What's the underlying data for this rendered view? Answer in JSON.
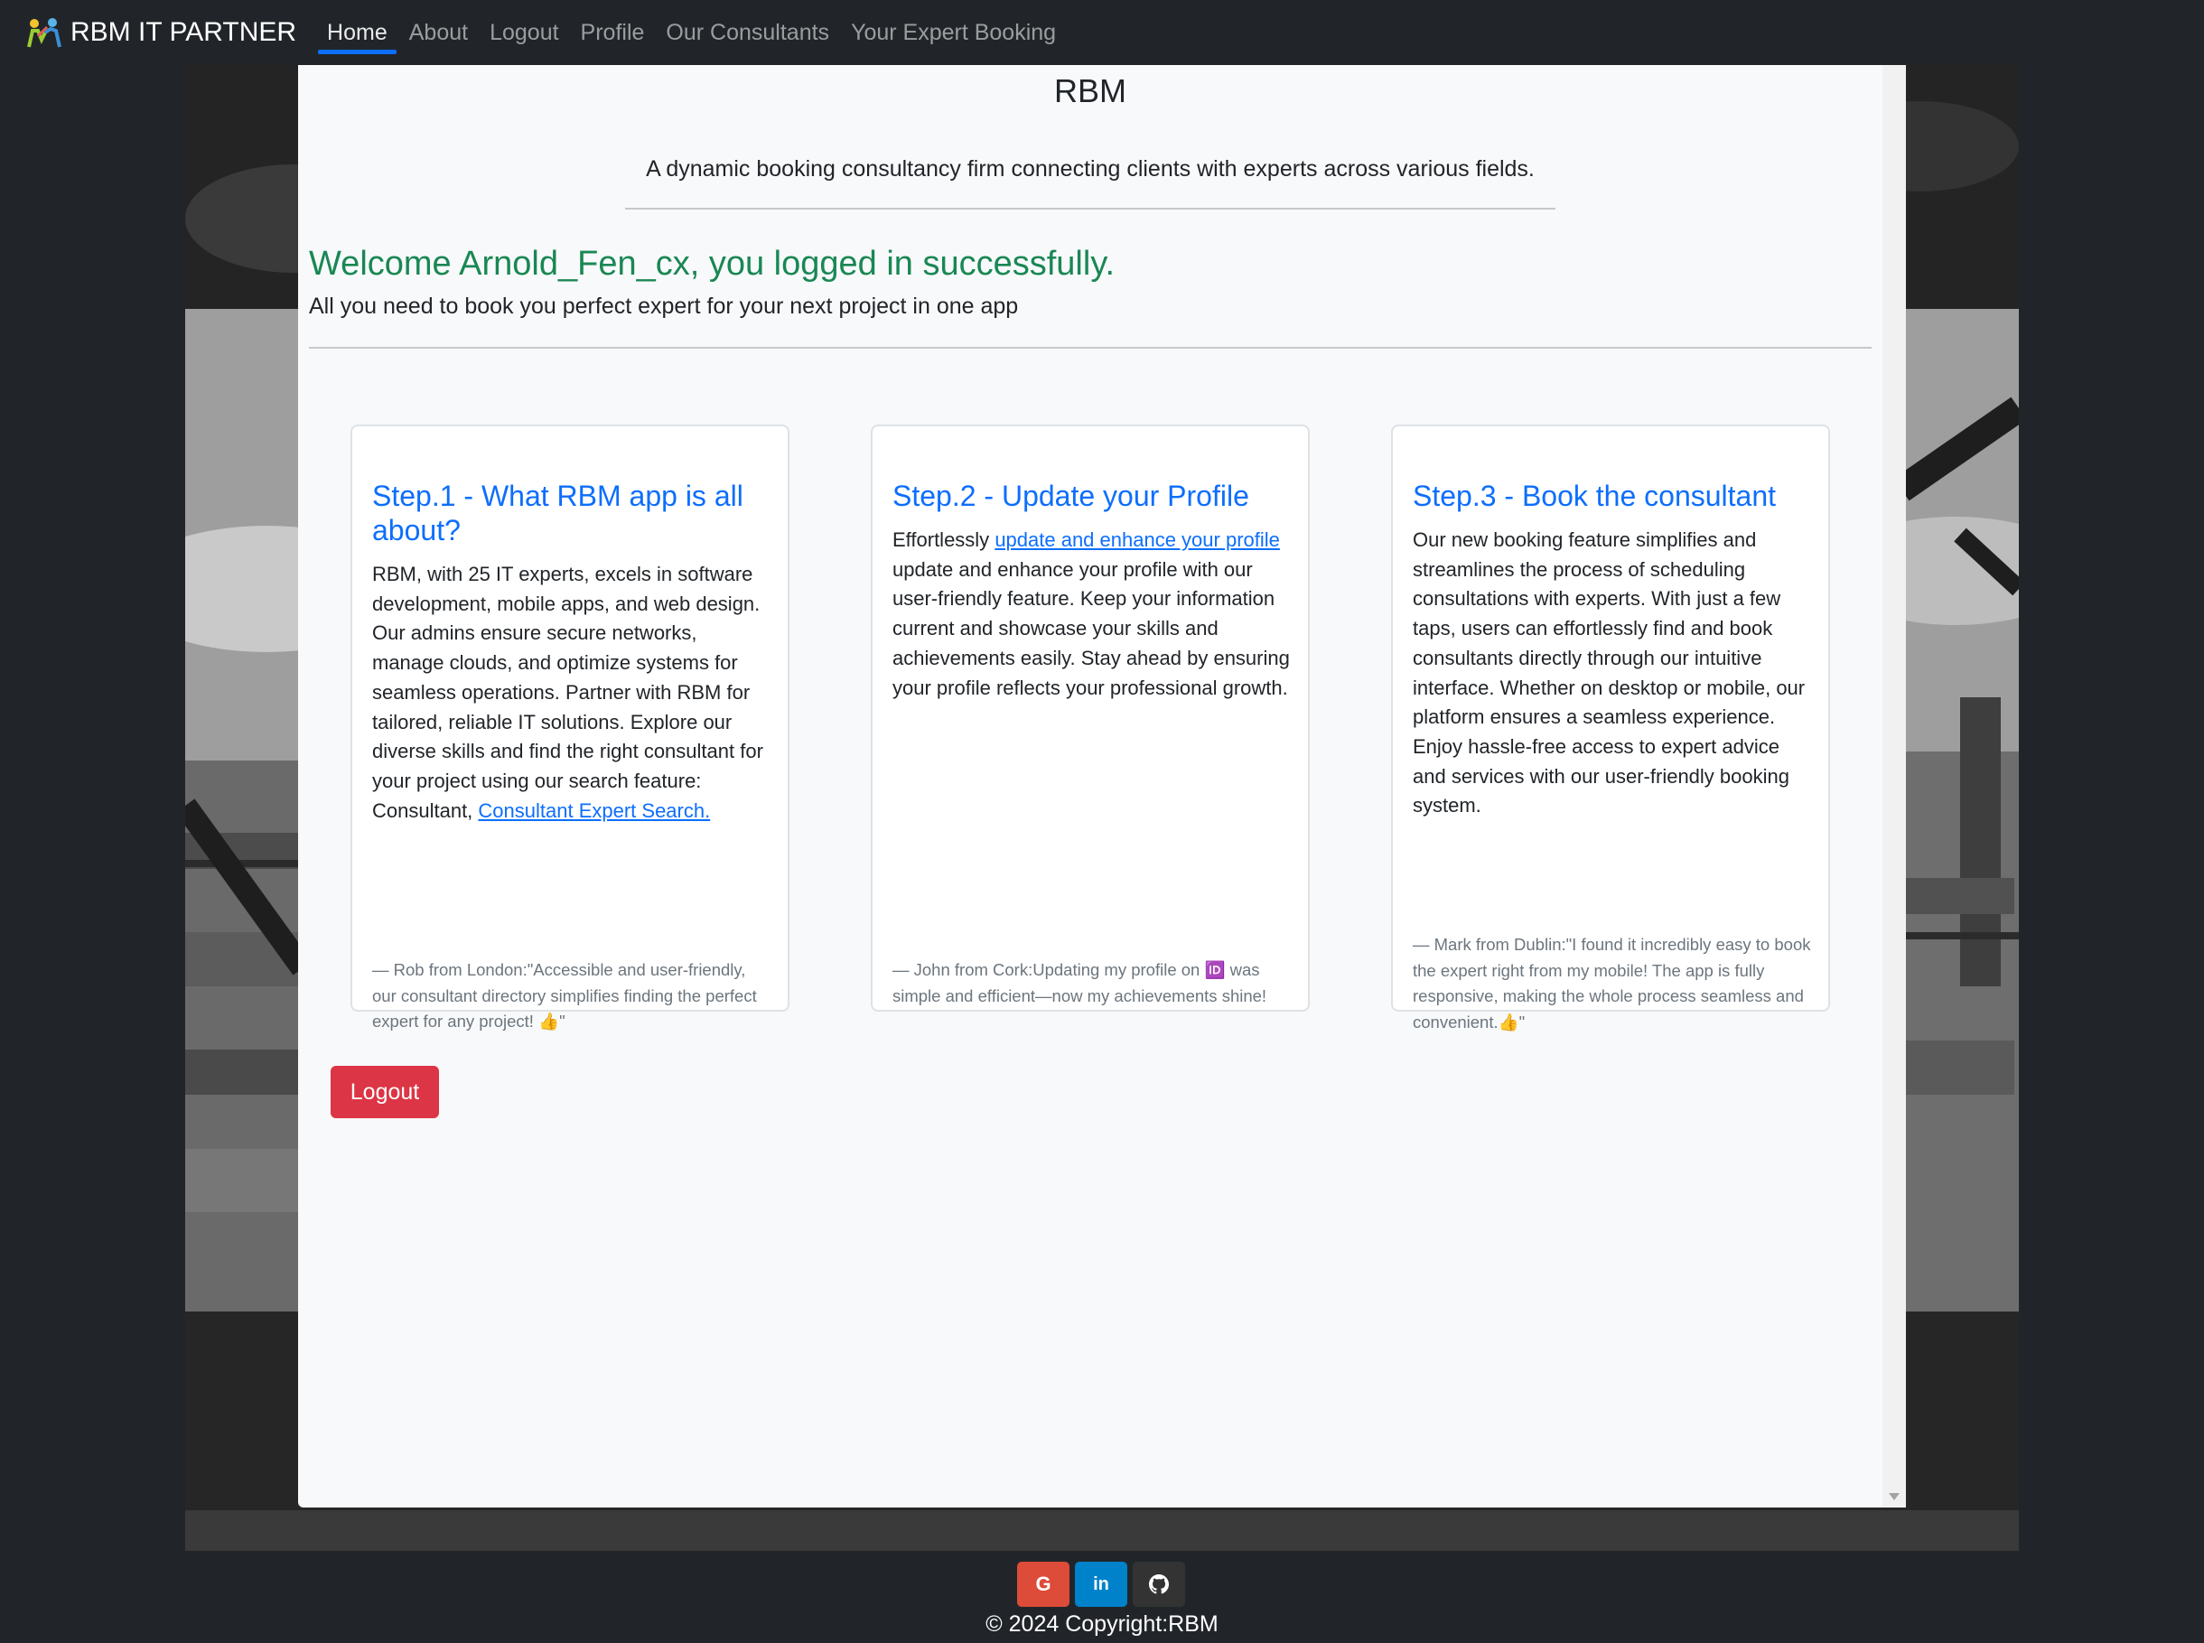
{
  "navbar": {
    "brand": "RBM IT PARTNER",
    "items": [
      {
        "label": "Home",
        "active": true
      },
      {
        "label": "About"
      },
      {
        "label": "Logout"
      },
      {
        "label": "Profile"
      },
      {
        "label": "Our Consultants"
      },
      {
        "label": "Your Expert Booking"
      }
    ]
  },
  "header": {
    "title": "RBM",
    "tagline": "A dynamic booking consultancy firm connecting clients with experts across various fields."
  },
  "welcome": {
    "message": "Welcome Arnold_Fen_cx, you logged in successfully.",
    "intro": "All you need to book you perfect expert for your next project in one app"
  },
  "cards": {
    "step1": {
      "title": "Step.1 - What RBM app is all about?",
      "text": "RBM, with 25 IT experts, excels in software development, mobile apps, and web design. Our admins ensure secure networks, manage clouds, and optimize systems for seamless operations. Partner with RBM for tailored, reliable IT solutions. Explore our diverse skills and find the right consultant for your project using our search feature: Consultant, ",
      "link": "Consultant Expert Search.",
      "quote": "— Rob from London:\"Accessible and user-friendly, our consultant directory simplifies finding the perfect expert for any project! 👍\""
    },
    "step2": {
      "title": "Step.2 - Update your Profile",
      "text_before": "Effortlessly ",
      "link": "update and enhance your profile",
      "text_after": " update and enhance your profile with our user-friendly feature. Keep your information current and showcase your skills and achievements easily. Stay ahead by ensuring your profile reflects your professional growth.",
      "quote": "— John from Cork:Updating my profile on 🆔 was simple and efficient—now my achievements shine!"
    },
    "step3": {
      "title": "Step.3 - Book the consultant",
      "text": "Our new booking feature simplifies and streamlines the process of scheduling consultations with experts. With just a few taps, users can effortlessly find and book consultants directly through our intuitive interface. Whether on desktop or mobile, our platform ensures a seamless experience. Enjoy hassle-free access to expert advice and services with our user-friendly booking system.",
      "quote": "— Mark from Dublin:\"I found it incredibly easy to book the expert right from my mobile! The app is fully responsive, making the whole process seamless and convenient.👍\""
    }
  },
  "logout_button": "Logout",
  "footer": {
    "copyright": "© 2024 Copyright:RBM",
    "social": [
      {
        "icon": "google-icon",
        "glyph": "G",
        "color": "#dd4b39"
      },
      {
        "icon": "linkedin-icon",
        "glyph": "in",
        "color": "#0082ca"
      },
      {
        "icon": "github-icon",
        "glyph": "",
        "color": "#333333"
      }
    ]
  },
  "colors": {
    "navbar": "#212529",
    "link": "#0d6efd",
    "success": "#198754",
    "danger": "#dc3545",
    "panel": "#f8f9fa"
  }
}
